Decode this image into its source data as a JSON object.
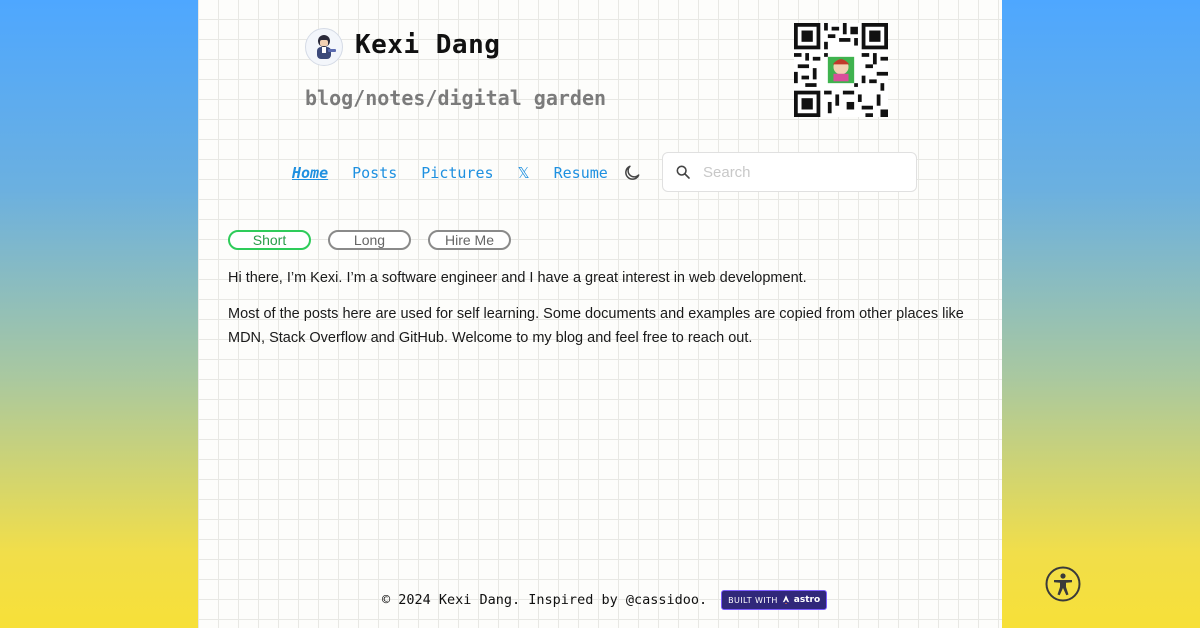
{
  "header": {
    "site_title": "Kexi Dang",
    "tagline": "blog/notes/digital garden"
  },
  "nav": {
    "home": "Home",
    "posts": "Posts",
    "pictures": "Pictures",
    "x": "𝕏",
    "resume": "Resume"
  },
  "search": {
    "placeholder": "Search"
  },
  "tabs": {
    "short": "Short",
    "long": "Long",
    "hire": "Hire Me",
    "selected": "Short"
  },
  "content": {
    "paragraph_1": "Hi there, I’m Kexi. I’m a software engineer and I have a great interest in web development.",
    "paragraph_2": "Most of the posts here are used for self learning. Some documents and examples are copied from other places like MDN, Stack Overflow and GitHub. Welcome to my blog and feel free to reach out."
  },
  "footer": {
    "copyright": "© 2024 Kexi Dang. Inspired by @cassidoo.",
    "badge_prefix": "BUILT WITH",
    "badge_brand": "astro"
  },
  "icons": {
    "avatar": "avatar-icon",
    "qr": "qr-code-icon",
    "theme": "moon-icon",
    "search": "search-icon",
    "accessibility": "accessibility-icon"
  },
  "colors": {
    "link": "#1e90e0",
    "selected_tab": "#2ecc5a",
    "badge_bg": "#30277a"
  }
}
